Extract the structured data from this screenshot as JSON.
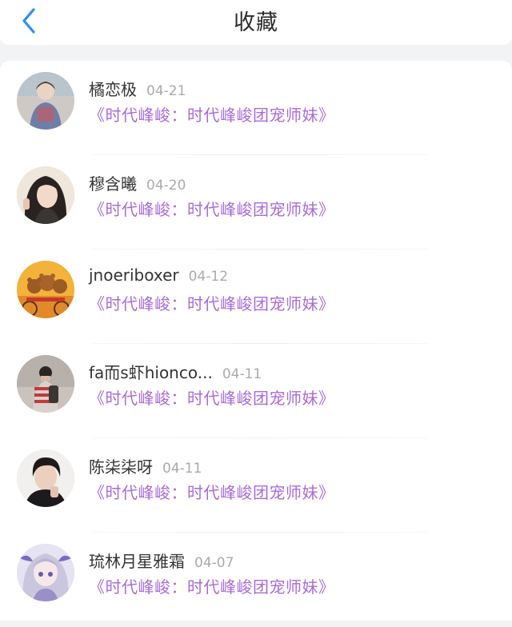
{
  "header": {
    "title": "收藏",
    "back_icon": "chevron-left-icon"
  },
  "colors": {
    "accent": "#2f8cf0",
    "link": "#a86bd9",
    "date": "#aaaaaa"
  },
  "favorites": [
    {
      "name": "橘恋极",
      "date": "04-21",
      "book": "《时代峰峻：时代峰峻团宠师妹》"
    },
    {
      "name": "穆含曦",
      "date": "04-20",
      "book": "《时代峰峻：时代峰峻团宠师妹》"
    },
    {
      "name": "jnoeriboxer",
      "date": "04-12",
      "book": "《时代峰峻：时代峰峻团宠师妹》"
    },
    {
      "name": "fa而s虾hionco...",
      "date": "04-11",
      "book": "《时代峰峻：时代峰峻团宠师妹》"
    },
    {
      "name": "陈柒柒呀",
      "date": "04-11",
      "book": "《时代峰峻：时代峰峻团宠师妹》"
    },
    {
      "name": "琉林月星雅霜",
      "date": "04-07",
      "book": "《时代峰峻：时代峰峻团宠师妹》"
    }
  ]
}
